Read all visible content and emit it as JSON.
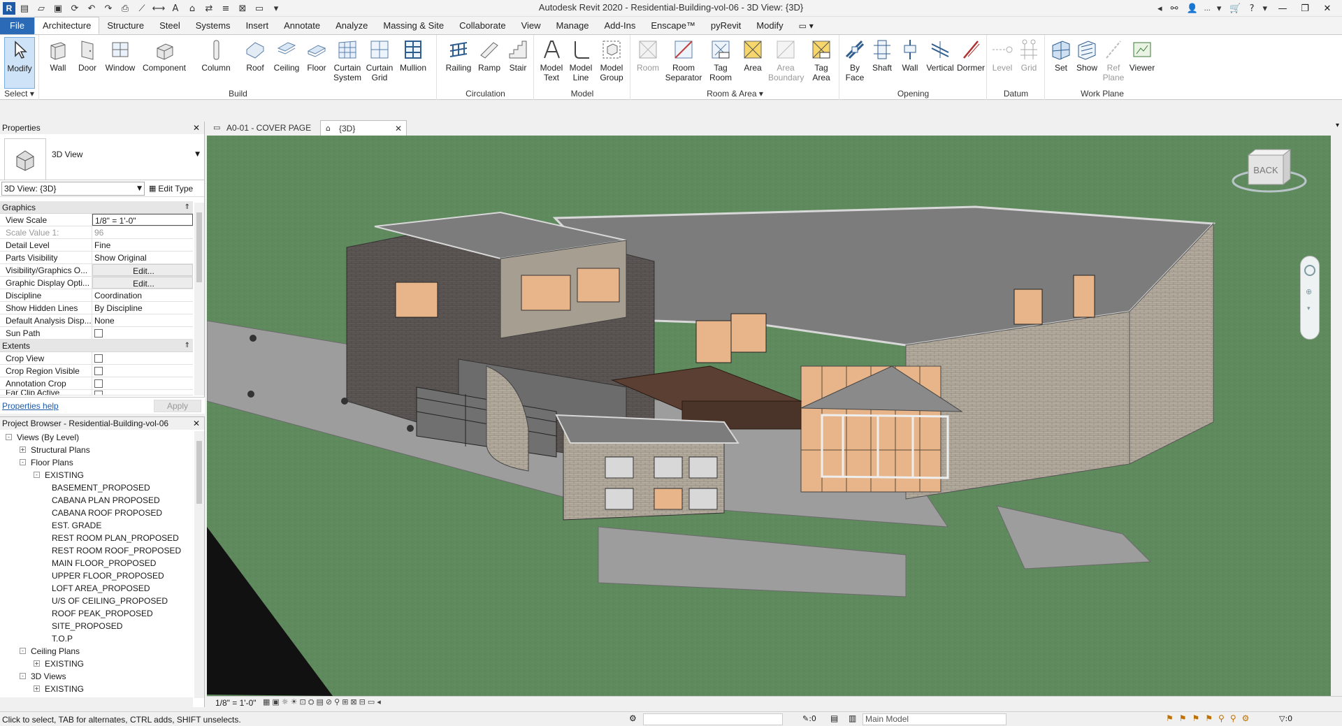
{
  "window": {
    "title": "Autodesk Revit 2020 - Residential-Building-vol-06 - 3D View: {3D}",
    "user": "...",
    "qat_icons": [
      "revit-logo-icon",
      "open-icon",
      "save-icon",
      "sync-icon",
      "undo-icon",
      "redo-icon",
      "print-icon",
      "measure-icon",
      "text-icon",
      "3d-view-icon",
      "section-icon",
      "thin-lines-icon",
      "close-hidden-icon",
      "switch-windows-icon"
    ]
  },
  "ribbon_tabs": [
    "File",
    "Architecture",
    "Structure",
    "Steel",
    "Systems",
    "Insert",
    "Annotate",
    "Analyze",
    "Massing & Site",
    "Collaborate",
    "View",
    "Manage",
    "Add-Ins",
    "Enscape™",
    "pyRevit",
    "Modify"
  ],
  "active_tab": "Architecture",
  "ribbon": {
    "select": {
      "label": "Select",
      "modify": "Modify"
    },
    "groups": [
      {
        "label": "Build",
        "buttons": [
          "Wall",
          "Door",
          "Window",
          "Component",
          "Column",
          "Roof",
          "Ceiling",
          "Floor",
          "Curtain System",
          "Curtain Grid",
          "Mullion"
        ]
      },
      {
        "label": "Circulation",
        "buttons": [
          "Railing",
          "Ramp",
          "Stair"
        ]
      },
      {
        "label": "Model",
        "buttons": [
          "Model Text",
          "Model Line",
          "Model Group"
        ]
      },
      {
        "label": "Room & Area",
        "buttons": [
          "Room",
          "Room Separator",
          "Tag Room",
          "Area",
          "Area Boundary",
          "Tag Area"
        ]
      },
      {
        "label": "Opening",
        "buttons": [
          "By Face",
          "Shaft",
          "Wall",
          "Vertical",
          "Dormer"
        ]
      },
      {
        "label": "Datum",
        "buttons": [
          "Level",
          "Grid"
        ]
      },
      {
        "label": "Work Plane",
        "buttons": [
          "Set",
          "Show",
          "Ref Plane",
          "Viewer"
        ]
      }
    ]
  },
  "properties": {
    "header": "Properties",
    "type_name": "3D View",
    "instance_selector": "3D View: {3D}",
    "edit_type": "Edit Type",
    "sections": [
      {
        "name": "Graphics",
        "rows": [
          {
            "key": "View Scale",
            "value": "1/8\" = 1'-0\""
          },
          {
            "key": "Scale Value    1:",
            "value": "96"
          },
          {
            "key": "Detail Level",
            "value": "Fine"
          },
          {
            "key": "Parts Visibility",
            "value": "Show Original"
          },
          {
            "key": "Visibility/Graphics O...",
            "value": "Edit..."
          },
          {
            "key": "Graphic Display Opti...",
            "value": "Edit..."
          },
          {
            "key": "Discipline",
            "value": "Coordination"
          },
          {
            "key": "Show Hidden Lines",
            "value": "By Discipline"
          },
          {
            "key": "Default Analysis Disp...",
            "value": "None"
          },
          {
            "key": "Sun Path",
            "value": ""
          }
        ]
      },
      {
        "name": "Extents",
        "rows": [
          {
            "key": "Crop View",
            "value": ""
          },
          {
            "key": "Crop Region Visible",
            "value": ""
          },
          {
            "key": "Annotation Crop",
            "value": ""
          },
          {
            "key": "Far Clip Active",
            "value": ""
          }
        ]
      }
    ],
    "help_link": "Properties help",
    "apply": "Apply"
  },
  "browser": {
    "header": "Project Browser - Residential-Building-vol-06",
    "tree": [
      {
        "label": "Views (By Level)",
        "level": 0,
        "toggle": "-"
      },
      {
        "label": "Structural Plans",
        "level": 1,
        "toggle": "+"
      },
      {
        "label": "Floor Plans",
        "level": 1,
        "toggle": "-"
      },
      {
        "label": "EXISTING",
        "level": 2,
        "toggle": "-"
      },
      {
        "label": "BASEMENT_PROPOSED",
        "level": 3,
        "toggle": ""
      },
      {
        "label": "CABANA PLAN PROPOSED",
        "level": 3,
        "toggle": ""
      },
      {
        "label": "CABANA ROOF PROPOSED",
        "level": 3,
        "toggle": ""
      },
      {
        "label": "EST. GRADE",
        "level": 3,
        "toggle": ""
      },
      {
        "label": "REST ROOM PLAN_PROPOSED",
        "level": 3,
        "toggle": ""
      },
      {
        "label": "REST ROOM ROOF_PROPOSED",
        "level": 3,
        "toggle": ""
      },
      {
        "label": "MAIN FLOOR_PROPOSED",
        "level": 3,
        "toggle": ""
      },
      {
        "label": "UPPER FLOOR_PROPOSED",
        "level": 3,
        "toggle": ""
      },
      {
        "label": "LOFT AREA_PROPOSED",
        "level": 3,
        "toggle": ""
      },
      {
        "label": "U/S OF CEILING_PROPOSED",
        "level": 3,
        "toggle": ""
      },
      {
        "label": "ROOF PEAK_PROPOSED",
        "level": 3,
        "toggle": ""
      },
      {
        "label": "SITE_PROPOSED",
        "level": 3,
        "toggle": ""
      },
      {
        "label": "T.O.P",
        "level": 3,
        "toggle": ""
      },
      {
        "label": "Ceiling Plans",
        "level": 1,
        "toggle": "-"
      },
      {
        "label": "EXISTING",
        "level": 2,
        "toggle": "+"
      },
      {
        "label": "3D Views",
        "level": 1,
        "toggle": "-"
      },
      {
        "label": "EXISTING",
        "level": 2,
        "toggle": "+"
      }
    ]
  },
  "view_tabs": [
    {
      "label": "A0-01 - COVER PAGE",
      "active": false
    },
    {
      "label": "{3D}",
      "active": true
    }
  ],
  "viewcube": {
    "face": "BACK"
  },
  "view_control_bar": {
    "scale": "1/8\" = 1'-0\""
  },
  "status_bar": {
    "message": "Click to select, TAB for alternates, CTRL adds, SHIFT unselects.",
    "workset_count": ":0",
    "model": "Main Model",
    "filter_count": ":0"
  },
  "colors": {
    "accent": "#2a6ab6",
    "ground": "#5f8a5d",
    "roof": "#7c7c7c",
    "glass": "#e8b58a"
  }
}
